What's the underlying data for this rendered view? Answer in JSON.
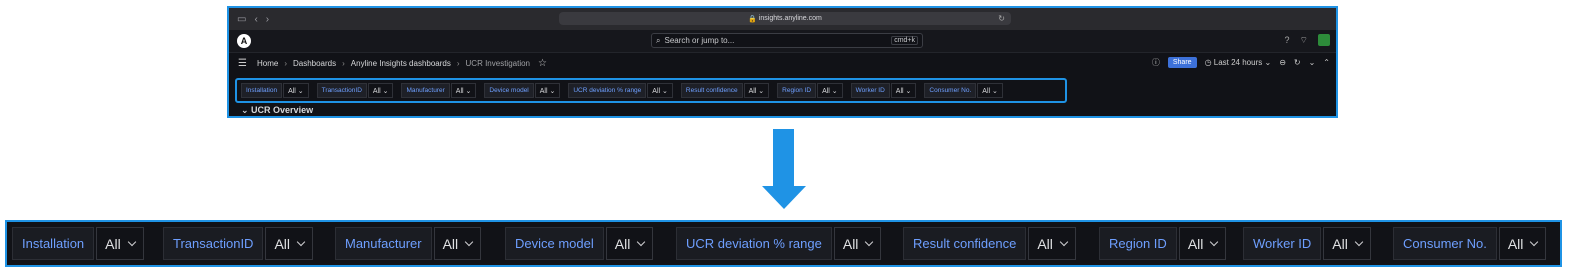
{
  "browser": {
    "url": "insights.anyline.com"
  },
  "grafana": {
    "search_placeholder": "Search or jump to...",
    "search_shortcut": "cmd+k",
    "breadcrumbs": [
      "Home",
      "Dashboards",
      "Anyline Insights dashboards",
      "UCR Investigation"
    ],
    "share_label": "Share",
    "time_range": "Last 24 hours",
    "row_title": "UCR Overview"
  },
  "filters": [
    {
      "label": "Installation",
      "value": "All"
    },
    {
      "label": "TransactionID",
      "value": "All"
    },
    {
      "label": "Manufacturer",
      "value": "All"
    },
    {
      "label": "Device model",
      "value": "All"
    },
    {
      "label": "UCR deviation % range",
      "value": "All"
    },
    {
      "label": "Result confidence",
      "value": "All"
    },
    {
      "label": "Region ID",
      "value": "All"
    },
    {
      "label": "Worker ID",
      "value": "All"
    },
    {
      "label": "Consumer No.",
      "value": "All"
    }
  ],
  "colors": {
    "highlight": "#1f93e5",
    "label_text": "#6e9fff",
    "background": "#111217"
  }
}
